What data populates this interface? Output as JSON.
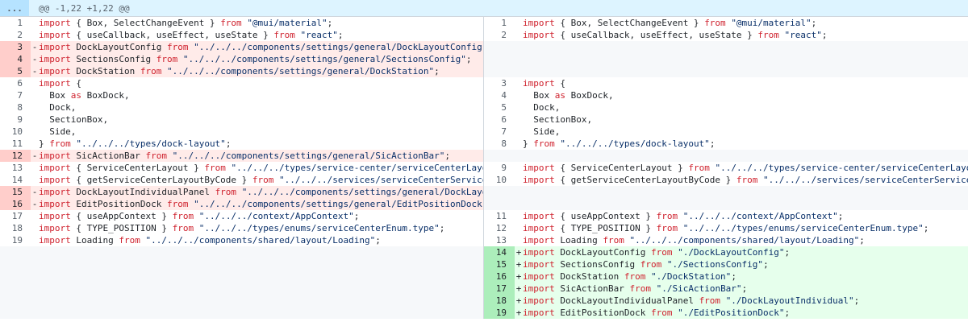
{
  "hunk": {
    "expand_label": "...",
    "header": "@@ -1,22 +1,22 @@"
  },
  "left": [
    {
      "n": "1",
      "t": "ctx",
      "c": "import { Box, SelectChangeEvent } from \"@mui/material\";"
    },
    {
      "n": "2",
      "t": "ctx",
      "c": "import { useCallback, useEffect, useState } from \"react\";"
    },
    {
      "n": "3",
      "t": "del",
      "c": "import DockLayoutConfig from \"../../../components/settings/general/DockLayoutConfig\";"
    },
    {
      "n": "4",
      "t": "del",
      "c": "import SectionsConfig from \"../../../components/settings/general/SectionsConfig\";"
    },
    {
      "n": "5",
      "t": "del",
      "c": "import DockStation from \"../../../components/settings/general/DockStation\";"
    },
    {
      "n": "6",
      "t": "ctx",
      "c": "import {"
    },
    {
      "n": "7",
      "t": "ctx",
      "c": "  Box as BoxDock,"
    },
    {
      "n": "8",
      "t": "ctx",
      "c": "  Dock,"
    },
    {
      "n": "9",
      "t": "ctx",
      "c": "  SectionBox,"
    },
    {
      "n": "10",
      "t": "ctx",
      "c": "  Side,"
    },
    {
      "n": "11",
      "t": "ctx",
      "c": "} from \"../../../types/dock-layout\";"
    },
    {
      "n": "12",
      "t": "del",
      "c": "import SicActionBar from \"../../../components/settings/general/SicActionBar\";"
    },
    {
      "n": "13",
      "t": "ctx",
      "c": "import { ServiceCenterLayout } from \"../../../types/service-center/serviceCenterLayout.type\";"
    },
    {
      "n": "14",
      "t": "ctx",
      "c": "import { getServiceCenterLayoutByCode } from \"../../../services/serviceCenterService\";"
    },
    {
      "n": "15",
      "t": "del",
      "c": "import DockLayoutIndividualPanel from \"../../../components/settings/general/DockLayoutIndividual\";"
    },
    {
      "n": "16",
      "t": "del",
      "c": "import EditPositionDock from \"../../../components/settings/general/EditPositionDock\";"
    },
    {
      "n": "17",
      "t": "ctx",
      "c": "import { useAppContext } from \"../../../context/AppContext\";"
    },
    {
      "n": "18",
      "t": "ctx",
      "c": "import { TYPE_POSITION } from \"../../../types/enums/serviceCenterEnum.type\";"
    },
    {
      "n": "19",
      "t": "ctx",
      "c": "import Loading from \"../../../components/shared/layout/Loading\";"
    },
    {
      "n": "",
      "t": "empty",
      "c": ""
    },
    {
      "n": "",
      "t": "empty",
      "c": ""
    },
    {
      "n": "",
      "t": "empty",
      "c": ""
    },
    {
      "n": "",
      "t": "empty",
      "c": ""
    },
    {
      "n": "",
      "t": "empty",
      "c": ""
    },
    {
      "n": "",
      "t": "empty",
      "c": ""
    }
  ],
  "right": [
    {
      "n": "1",
      "t": "ctx",
      "c": "import { Box, SelectChangeEvent } from \"@mui/material\";"
    },
    {
      "n": "2",
      "t": "ctx",
      "c": "import { useCallback, useEffect, useState } from \"react\";"
    },
    {
      "n": "",
      "t": "empty",
      "c": ""
    },
    {
      "n": "",
      "t": "empty",
      "c": ""
    },
    {
      "n": "",
      "t": "empty",
      "c": ""
    },
    {
      "n": "3",
      "t": "ctx",
      "c": "import {"
    },
    {
      "n": "4",
      "t": "ctx",
      "c": "  Box as BoxDock,"
    },
    {
      "n": "5",
      "t": "ctx",
      "c": "  Dock,"
    },
    {
      "n": "6",
      "t": "ctx",
      "c": "  SectionBox,"
    },
    {
      "n": "7",
      "t": "ctx",
      "c": "  Side,"
    },
    {
      "n": "8",
      "t": "ctx",
      "c": "} from \"../../../types/dock-layout\";"
    },
    {
      "n": "",
      "t": "empty",
      "c": ""
    },
    {
      "n": "9",
      "t": "ctx",
      "c": "import { ServiceCenterLayout } from \"../../../types/service-center/serviceCenterLayout.type\";"
    },
    {
      "n": "10",
      "t": "ctx",
      "c": "import { getServiceCenterLayoutByCode } from \"../../../services/serviceCenterService\";"
    },
    {
      "n": "",
      "t": "empty",
      "c": ""
    },
    {
      "n": "",
      "t": "empty",
      "c": ""
    },
    {
      "n": "11",
      "t": "ctx",
      "c": "import { useAppContext } from \"../../../context/AppContext\";"
    },
    {
      "n": "12",
      "t": "ctx",
      "c": "import { TYPE_POSITION } from \"../../../types/enums/serviceCenterEnum.type\";"
    },
    {
      "n": "13",
      "t": "ctx",
      "c": "import Loading from \"../../../components/shared/layout/Loading\";"
    },
    {
      "n": "14",
      "t": "add",
      "c": "import DockLayoutConfig from \"./DockLayoutConfig\";"
    },
    {
      "n": "15",
      "t": "add",
      "c": "import SectionsConfig from \"./SectionsConfig\";"
    },
    {
      "n": "16",
      "t": "add",
      "c": "import DockStation from \"./DockStation\";"
    },
    {
      "n": "17",
      "t": "add",
      "c": "import SicActionBar from \"./SicActionBar\";"
    },
    {
      "n": "18",
      "t": "add",
      "c": "import DockLayoutIndividualPanel from \"./DockLayoutIndividual\";"
    },
    {
      "n": "19",
      "t": "add",
      "c": "import EditPositionDock from \"./EditPositionDock\";"
    }
  ],
  "markers": {
    "del": "-",
    "add": "+"
  },
  "colors": {
    "deleted_bg": "#ffebe9",
    "added_bg": "#e6ffec",
    "hunk_bg": "#ddf4ff"
  }
}
